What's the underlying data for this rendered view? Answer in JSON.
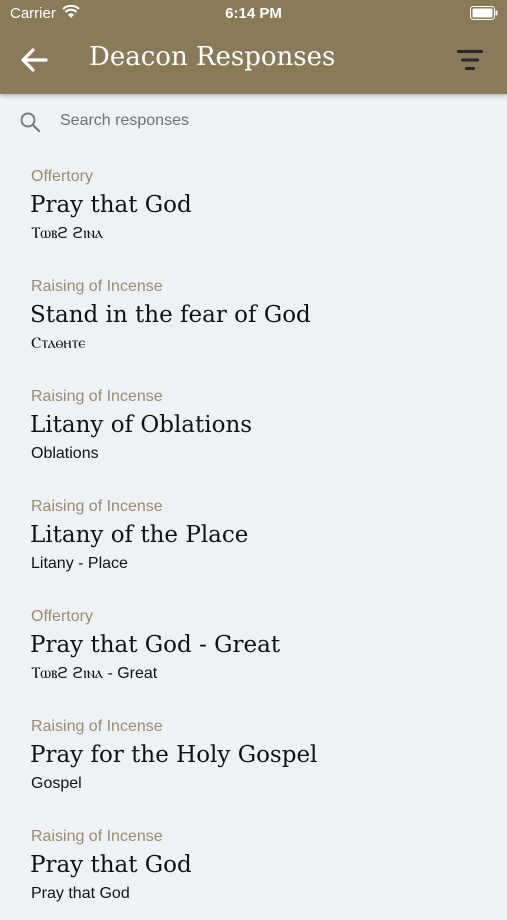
{
  "status_bar": {
    "carrier": "Carrier",
    "time": "6:14 PM"
  },
  "header": {
    "title": "Deacon Responses",
    "background_color": "#8b7a5a",
    "back_icon": "arrow-left-icon",
    "filter_icon": "filter-icon"
  },
  "search": {
    "placeholder": "Search responses",
    "value": ""
  },
  "responses": [
    {
      "category": "Offertory",
      "title": "Pray that God",
      "subtitle": "Ⲧⲱⲃϩ ϩⲓⲛⲁ"
    },
    {
      "category": "Raising of Incense",
      "title": "Stand in the fear of God",
      "subtitle": "Ⲥⲧⲁⲑⲏⲧⲉ"
    },
    {
      "category": "Raising of Incense",
      "title": "Litany of Oblations",
      "subtitle": "Oblations"
    },
    {
      "category": "Raising of Incense",
      "title": "Litany of the Place",
      "subtitle": "Litany - Place"
    },
    {
      "category": "Offertory",
      "title": "Pray that God - Great",
      "subtitle": "Ⲧⲱⲃϩ ϩⲓⲛⲁ - Great"
    },
    {
      "category": "Raising of Incense",
      "title": "Pray for the Holy Gospel",
      "subtitle": "Gospel"
    },
    {
      "category": "Raising of Incense",
      "title": "Pray that God",
      "subtitle": "Pray that God"
    }
  ],
  "colors": {
    "category_text": "#9a8b6a",
    "background": "#eef2f6"
  }
}
